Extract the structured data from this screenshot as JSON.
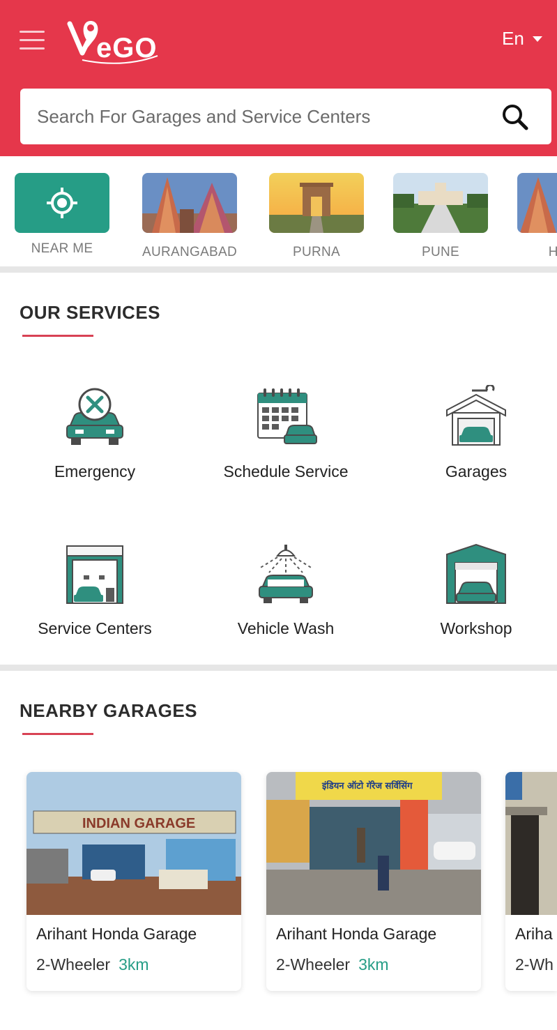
{
  "header": {
    "logo_text": "VeGO",
    "language": "En",
    "search": {
      "placeholder": "Search For Garages and Service Centers",
      "value": ""
    }
  },
  "cities": [
    {
      "label": "NEAR ME",
      "icon": "location-target-icon"
    },
    {
      "label": "AURANGABAD"
    },
    {
      "label": "PURNA"
    },
    {
      "label": "PUNE"
    },
    {
      "label": "HYDI"
    }
  ],
  "services_section": {
    "title": "OUR SERVICES",
    "items": [
      {
        "label": "Emergency",
        "icon": "emergency-repair-icon"
      },
      {
        "label": "Schedule Service",
        "icon": "calendar-car-icon"
      },
      {
        "label": "Garages",
        "icon": "garage-icon"
      },
      {
        "label": "Service Centers",
        "icon": "service-center-icon"
      },
      {
        "label": "Vehicle Wash",
        "icon": "car-wash-icon"
      },
      {
        "label": "Workshop",
        "icon": "workshop-icon"
      }
    ]
  },
  "nearby_section": {
    "title": "NEARBY GARAGES",
    "garages": [
      {
        "name": "Arihant Honda Garage",
        "type": "2-Wheeler",
        "distance": "3km",
        "sign_text": "INDIAN GARAGE"
      },
      {
        "name": "Arihant Honda Garage",
        "type": "2-Wheeler",
        "distance": "3km",
        "sign_text": "इंडियन ऑटो गॅरेज सर्विसिंग"
      },
      {
        "name": "Ariha",
        "type": "2-Wh",
        "distance": ""
      }
    ]
  },
  "colors": {
    "brand": "#e5374b",
    "accent": "#269d86",
    "icon_gray": "#5a5a5a"
  }
}
